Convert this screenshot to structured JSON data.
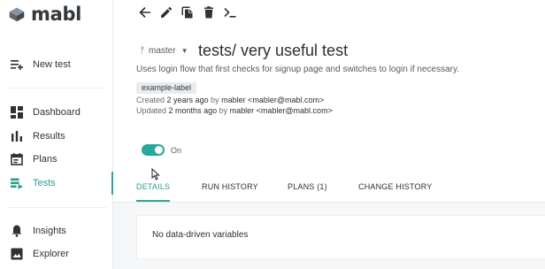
{
  "brand": {
    "name": "mabl",
    "accent": "#2aa79b"
  },
  "sidebar": {
    "items": [
      {
        "label": "New test",
        "icon": "new-test-icon"
      },
      {
        "label": "Dashboard",
        "icon": "dashboard-icon"
      },
      {
        "label": "Results",
        "icon": "results-icon"
      },
      {
        "label": "Plans",
        "icon": "plans-icon"
      },
      {
        "label": "Tests",
        "icon": "tests-icon",
        "active": true
      },
      {
        "label": "Insights",
        "icon": "insights-icon"
      },
      {
        "label": "Explorer",
        "icon": "explorer-icon"
      }
    ]
  },
  "toolbar": {
    "buttons": [
      "back-arrow-icon",
      "edit-pencil-icon",
      "copy-icon",
      "delete-trash-icon",
      "terminal-icon"
    ]
  },
  "test": {
    "branch": "master",
    "title": "tests/ very useful test",
    "description": "Uses login flow that first checks for signup page and switches to login if necessary.",
    "label": "example-label",
    "created_prefix": "Created",
    "created_when": "2 years ago",
    "created_by_prefix": "by",
    "created_by": "mabler <mabler@mabl.com>",
    "updated_prefix": "Updated",
    "updated_when": "2 months ago",
    "updated_by_prefix": "by",
    "updated_by": "mabler <mabler@mabl.com>",
    "enabled_label": "On",
    "enabled": true
  },
  "tabs": [
    {
      "label": "DETAILS",
      "active": true
    },
    {
      "label": "RUN HISTORY"
    },
    {
      "label": "PLANS (1)"
    },
    {
      "label": "CHANGE HISTORY"
    }
  ],
  "details": {
    "empty_message": "No data-driven variables"
  }
}
